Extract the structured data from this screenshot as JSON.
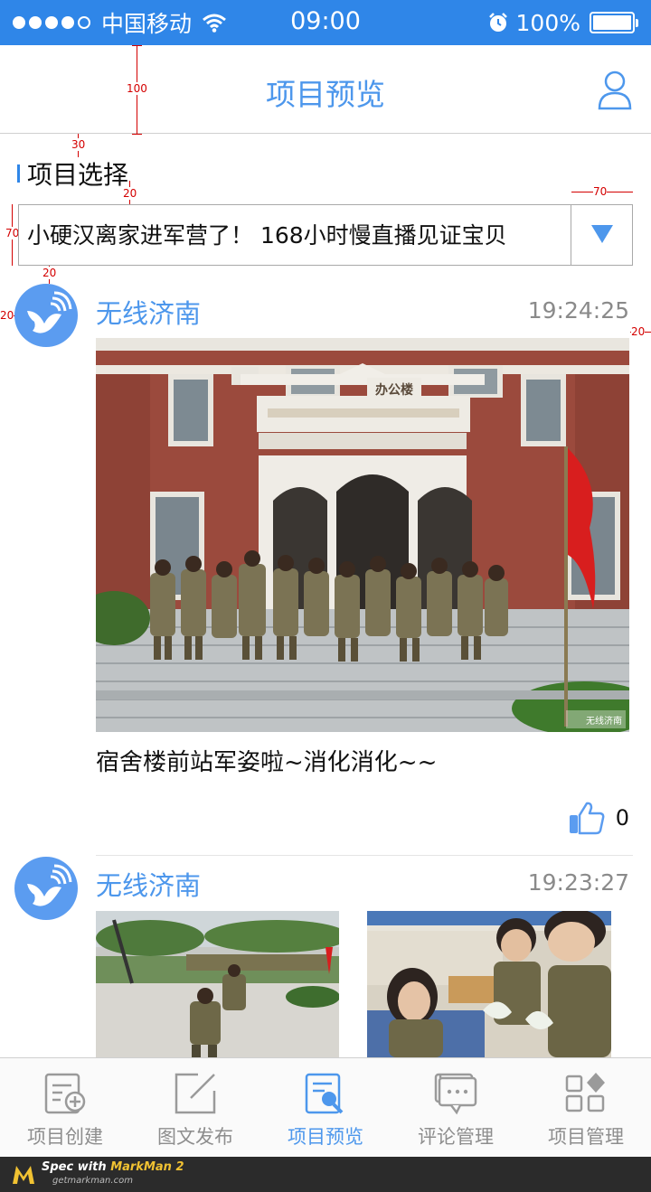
{
  "status_bar": {
    "carrier": "中国移动",
    "time": "09:00",
    "battery": "100%"
  },
  "header": {
    "title": "项目预览"
  },
  "spec_labels": {
    "header_height": "100",
    "section_top": "30",
    "label_gap": "20",
    "select_height": "70",
    "select_gap": "20",
    "arrow_width": "70",
    "left_margin": "20",
    "right_margin": "20"
  },
  "project_select": {
    "label": "项目选择",
    "value": "小硬汉离家进军营了！ 168小时慢直播见证宝贝"
  },
  "posts": [
    {
      "author": "无线济南",
      "time": "19:24:25",
      "caption": "宿舍楼前站军姿啦~消化消化~~",
      "likes": "0",
      "photo_sign": "办公楼",
      "photo_watermark": "无线济南"
    },
    {
      "author": "无线济南",
      "time": "19:23:27"
    }
  ],
  "tabs": [
    {
      "label": "项目创建",
      "active": false
    },
    {
      "label": "图文发布",
      "active": false
    },
    {
      "label": "项目预览",
      "active": true
    },
    {
      "label": "评论管理",
      "active": false
    },
    {
      "label": "项目管理",
      "active": false
    }
  ],
  "footer": {
    "spec_with": "Spec with ",
    "product": "MarkMan 2",
    "url": "getmarkman.com"
  },
  "colors": {
    "accent": "#2f86e8",
    "title_blue": "#4d97ec",
    "time_gray": "#8a8a8a"
  }
}
